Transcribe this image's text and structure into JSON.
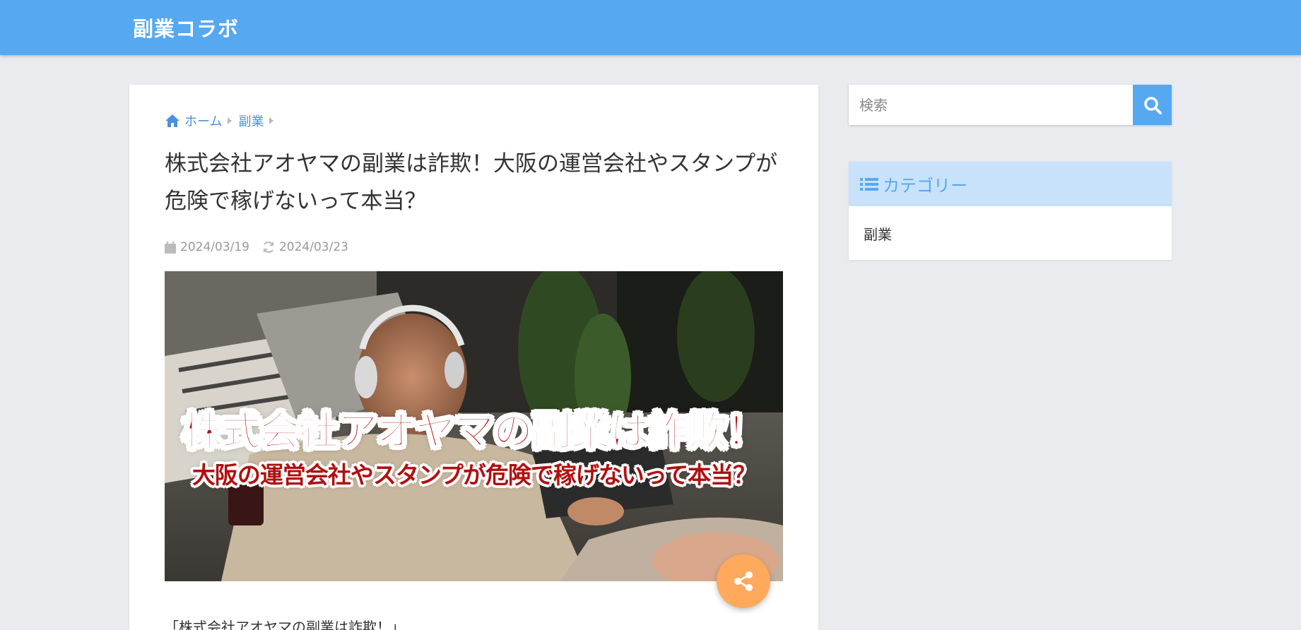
{
  "header": {
    "site_title": "副業コラボ",
    "bg_color": "#56a8f0"
  },
  "breadcrumb": {
    "items": [
      {
        "label": "ホーム",
        "icon": "home-icon"
      },
      {
        "label": "副業"
      }
    ]
  },
  "post": {
    "title": "株式会社アオヤマの副業は詐欺！大阪の運営会社やスタンプが危険で稼げないって本当？",
    "published_date": "2024/03/19",
    "updated_date": "2024/03/23",
    "eyecatch": {
      "line1": "株式会社アオヤマの副業は詐欺！",
      "line2": "大阪の運営会社やスタンプが危険で稼げないって本当？"
    },
    "intro_text": "「株式会社アオヤマの副業は詐欺！」"
  },
  "share": {
    "icon": "share-icon",
    "color": "#ffa95c"
  },
  "sidebar": {
    "search": {
      "placeholder": "検索",
      "value": ""
    },
    "categories": {
      "title": "カテゴリー",
      "items": [
        {
          "label": "副業"
        }
      ]
    }
  }
}
